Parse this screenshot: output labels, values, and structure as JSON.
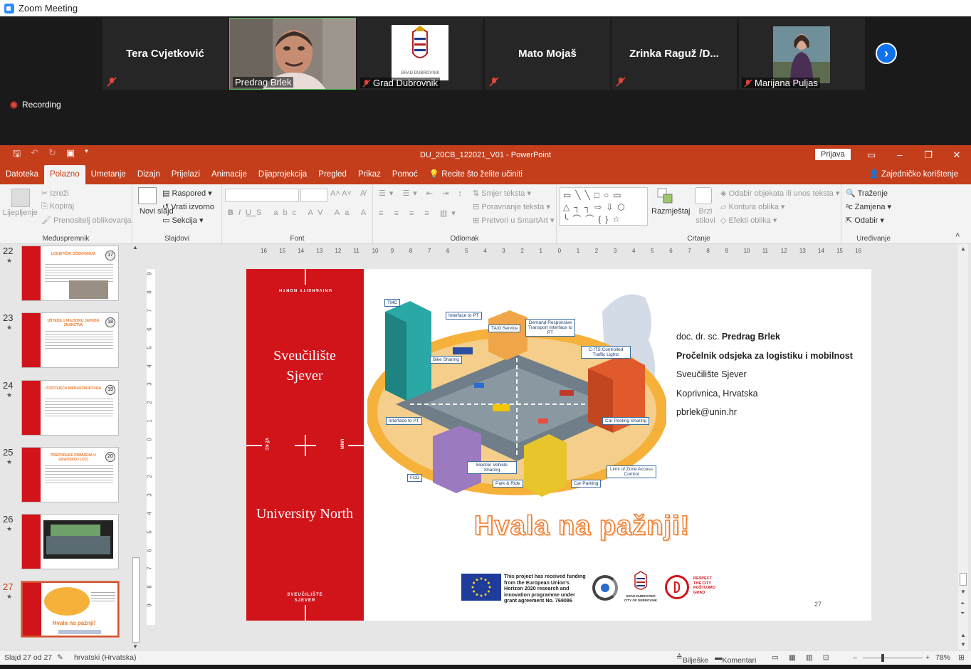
{
  "app": {
    "title": "Zoom Meeting"
  },
  "participants": [
    {
      "name": "Tera Cvjetković",
      "muted": true
    },
    {
      "name": "Predrag Brlek",
      "muted": false,
      "video": true
    },
    {
      "name": "Grad Dubrovnik",
      "muted": true,
      "logo_caption": "GRAD DUBROVNIK"
    },
    {
      "name": "Mato Mojaš",
      "muted": true
    },
    {
      "name": "Zrinka  Raguž /D...",
      "muted": true
    },
    {
      "name": "Marijana Puljas",
      "muted": true,
      "video": true
    }
  ],
  "recording": {
    "label": "Recording"
  },
  "ppt": {
    "doc_title": "DU_20CB_122021_V01  -  PowerPoint",
    "signin": "Prijava",
    "tabs": [
      "Datoteka",
      "Polazno",
      "Umetanje",
      "Dizajn",
      "Prijelazi",
      "Animacije",
      "Dijaprojekcija",
      "Pregled",
      "Prikaz",
      "Pomoć"
    ],
    "active_tab": "Polazno",
    "tell_me": "Recite što želite učiniti",
    "share": "Zajedničko korištenje",
    "ribbon": {
      "clipboard": {
        "paste": "Lijepljenje",
        "cut": "Izreži",
        "copy": "Kopiraj",
        "format_painter": "Prenositelj oblikovanja",
        "label": "Međuspremnik"
      },
      "slides": {
        "new_slide": "Novi slajd",
        "layout": "Raspored",
        "reset": "Vrati izvorno",
        "section": "Sekcija",
        "label": "Slajdovi"
      },
      "font": {
        "label": "Font"
      },
      "paragraph": {
        "text_direction": "Smjer teksta",
        "align_text": "Poravnanje teksta",
        "smartart": "Pretvori u SmartArt",
        "label": "Odlomak"
      },
      "drawing": {
        "arrange": "Razmještaj",
        "quick_styles": "Brzi stilovi",
        "fill": "Odabir objekata ili unos teksta",
        "outline": "Kontura oblika",
        "effects": "Efekti oblika",
        "label": "Crtanje"
      },
      "editing": {
        "find": "Traženje",
        "replace": "Zamjena",
        "select": "Odabir",
        "label": "Uređivanje"
      }
    },
    "thumbnails": [
      {
        "num": "22",
        "title": "LOGISTIČKI OČEKIVANJA",
        "badge": "17"
      },
      {
        "num": "23",
        "title": "UŠTEDE U MAJSTRU JAVNOG ZNANSTVA",
        "badge": "18"
      },
      {
        "num": "24",
        "title": "POSTOJEĆA INFRASTRUKTURA",
        "badge": "19"
      },
      {
        "num": "25",
        "title": "PREPORUKE PRIMJENA U GRADSKOJ LUCI",
        "badge": "20"
      },
      {
        "num": "26",
        "title": "",
        "badge": ""
      },
      {
        "num": "27",
        "title": "Hvala na pažnji!",
        "badge": "",
        "selected": true
      }
    ],
    "slide": {
      "uni_hr": "Sveučilište Sjever",
      "uni_en": "University North",
      "side_small_top": "UNIVERSITY NORTH",
      "side_small_bottom": "SVEUČILIŠTE SJEVER",
      "side_left_code": "VŽ KC",
      "side_right_code": "UNIN",
      "diagram_labels": [
        "TMC",
        "Interface to PT",
        "TAXI Service",
        "Demand Responsive Transport Interface to PT",
        "C-ITS Controlled Traffic Lights",
        "Bike Sharing",
        "Interface to PT",
        "Car Pooling Sharing",
        "FCD",
        "Electric Vehicle Sharing",
        "Park & Ride",
        "Limit of Zone Access Control",
        "Car Parking"
      ],
      "contact": {
        "title_prefix": "doc. dr. sc. ",
        "name": "Predrag Brlek",
        "position": "Pročelnik odsjeka za logistiku i mobilnost",
        "org": "Sveučilište Sjever",
        "city": "Koprivnica, Hrvatska",
        "email": "pbrlek@unin.hr"
      },
      "thanks": "Hvala na pažnji!",
      "eu_text": "This project has received funding from the European Union's Horizon 2020 research and innovation programme under grant agreement No. 769086",
      "dubrovnik_caption": "GRAD DUBROVNIK CITY OF DUBROVNIK",
      "respect": "RESPECT THE CITY POŠTUJMO GRAD",
      "page_num": "27"
    },
    "status": {
      "slide_of": "Slajd 27 od 27",
      "language": "hrvatski (Hrvatska)",
      "notes": "Bilješke",
      "comments": "Komentari",
      "zoom": "78%"
    },
    "ruler_h": [
      "16",
      "15",
      "14",
      "13",
      "12",
      "11",
      "10",
      "9",
      "8",
      "7",
      "6",
      "5",
      "4",
      "3",
      "2",
      "1",
      "0",
      "1",
      "2",
      "3",
      "4",
      "5",
      "6",
      "7",
      "8",
      "9",
      "10",
      "11",
      "12",
      "13",
      "14",
      "15",
      "16"
    ],
    "ruler_v": [
      "9",
      "8",
      "7",
      "6",
      "5",
      "4",
      "3",
      "2",
      "1",
      "0",
      "1",
      "2",
      "3",
      "4",
      "5",
      "6",
      "7",
      "8",
      "9"
    ]
  },
  "colors": {
    "ppt_accent": "#c43e1c",
    "slide_red": "#d1131a",
    "zoom_blue": "#0e72ed",
    "thanks_orange": "#f07a2a"
  }
}
